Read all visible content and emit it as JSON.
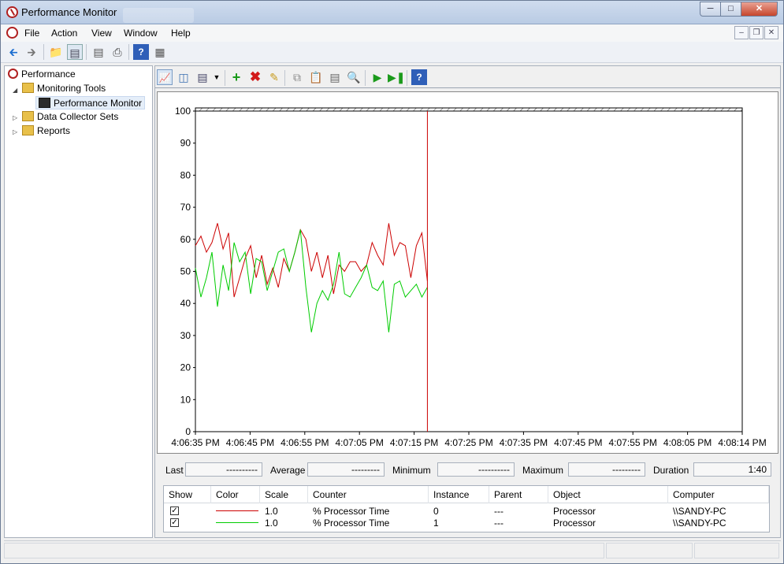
{
  "window": {
    "title": "Performance Monitor"
  },
  "menu": [
    "File",
    "Action",
    "View",
    "Window",
    "Help"
  ],
  "tree": {
    "root": "Performance",
    "monitoring_tools": "Monitoring Tools",
    "performance_monitor": "Performance Monitor",
    "data_collector_sets": "Data Collector Sets",
    "reports": "Reports"
  },
  "stats": {
    "last_label": "Last",
    "last_value": "----------",
    "average_label": "Average",
    "average_value": "---------",
    "minimum_label": "Minimum",
    "minimum_value": "----------",
    "maximum_label": "Maximum",
    "maximum_value": "---------",
    "duration_label": "Duration",
    "duration_value": "1:40"
  },
  "legend": {
    "headers": [
      "Show",
      "Color",
      "Scale",
      "Counter",
      "Instance",
      "Parent",
      "Object",
      "Computer"
    ],
    "rows": [
      {
        "show": "✓",
        "color": "#cc0000",
        "scale": "1.0",
        "counter": "% Processor Time",
        "instance": "0",
        "parent": "---",
        "object": "Processor",
        "computer": "\\\\SANDY-PC"
      },
      {
        "show": "✓",
        "color": "#00cc00",
        "scale": "1.0",
        "counter": "% Processor Time",
        "instance": "1",
        "parent": "---",
        "object": "Processor",
        "computer": "\\\\SANDY-PC"
      }
    ]
  },
  "chart_data": {
    "type": "line",
    "ylim": [
      0,
      100
    ],
    "yticks": [
      0,
      10,
      20,
      30,
      40,
      50,
      60,
      70,
      80,
      90,
      100
    ],
    "xtick_labels": [
      "4:06:35 PM",
      "4:06:45 PM",
      "4:06:55 PM",
      "4:07:05 PM",
      "4:07:15 PM",
      "4:07:25 PM",
      "4:07:35 PM",
      "4:07:45 PM",
      "4:07:55 PM",
      "4:08:05 PM",
      "4:08:14 PM"
    ],
    "x_range_seconds": [
      0,
      99
    ],
    "current_time_seconds": 42,
    "series": [
      {
        "color": "#cc0000",
        "x": [
          0,
          1,
          2,
          3,
          4,
          5,
          6,
          7,
          8,
          9,
          10,
          11,
          12,
          13,
          14,
          15,
          16,
          17,
          18,
          19,
          20,
          21,
          22,
          23,
          24,
          25,
          26,
          27,
          28,
          29,
          30,
          31,
          32,
          33,
          34,
          35,
          36,
          37,
          38,
          39,
          40,
          41,
          42
        ],
        "values": [
          58,
          61,
          56,
          59,
          65,
          57,
          62,
          42,
          48,
          54,
          58,
          48,
          55,
          46,
          51,
          45,
          54,
          50,
          56,
          63,
          60,
          50,
          56,
          48,
          55,
          43,
          52,
          50,
          53,
          53,
          50,
          52,
          59,
          55,
          52,
          65,
          55,
          59,
          58,
          48,
          58,
          62,
          47
        ]
      },
      {
        "color": "#00cc00",
        "x": [
          0,
          1,
          2,
          3,
          4,
          5,
          6,
          7,
          8,
          9,
          10,
          11,
          12,
          13,
          14,
          15,
          16,
          17,
          18,
          19,
          20,
          21,
          22,
          23,
          24,
          25,
          26,
          27,
          28,
          29,
          30,
          31,
          32,
          33,
          34,
          35,
          36,
          37,
          38,
          39,
          40,
          41,
          42
        ],
        "values": [
          51,
          42,
          48,
          56,
          39,
          52,
          44,
          59,
          53,
          56,
          43,
          54,
          53,
          44,
          50,
          56,
          57,
          50,
          56,
          63,
          45,
          31,
          40,
          44,
          41,
          46,
          56,
          43,
          42,
          45,
          48,
          52,
          45,
          44,
          47,
          31,
          46,
          47,
          42,
          44,
          46,
          42,
          45
        ]
      }
    ]
  }
}
